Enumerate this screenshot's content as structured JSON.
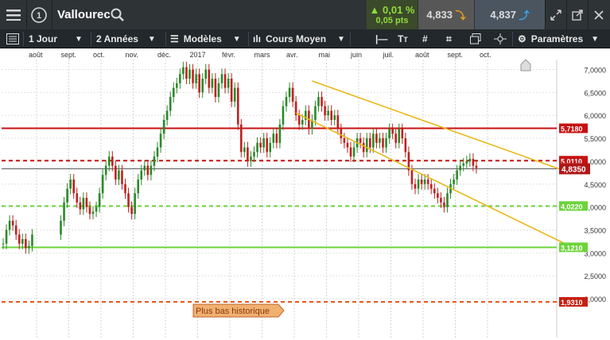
{
  "header": {
    "menu_icon": "hamburger-menu-icon",
    "instrument_icon": "number-one-circle-icon",
    "instrument_badge": "1",
    "title": "Vallourec",
    "search_icon": "search-icon",
    "change_pct": "0,01 %",
    "change_pts": "0,05 pts",
    "bid": "4,833",
    "ask": "4,837",
    "fullscreen_icon": "expand-icon",
    "popout_icon": "external-window-icon",
    "close_icon": "close-icon"
  },
  "toolbar": {
    "period": "1 Jour",
    "range": "2 Années",
    "models": "Modèles",
    "indicator": "Cours Moyen",
    "params": "Paramètres"
  },
  "chart_data": {
    "type": "candlestick",
    "x_tick_labels": [
      "août",
      "sept.",
      "oct.",
      "nov.",
      "déc.",
      "2017",
      "févr.",
      "mars",
      "avr.",
      "mai",
      "juin",
      "juil.",
      "août",
      "sept.",
      "oct."
    ],
    "y_tick_labels": [
      "7,0000",
      "6,5000",
      "6,0000",
      "5,5000",
      "5,0000",
      "4,5000",
      "4,0000",
      "3,5000",
      "3,0000",
      "2,5000",
      "2,0000"
    ],
    "ylim": [
      1.9,
      7.1
    ],
    "price_line": {
      "value": 4.835,
      "label": "4,8350",
      "color": "#b01818"
    },
    "levels": [
      {
        "value": 5.718,
        "label": "5,7180",
        "style": "solid",
        "color": "#c81010"
      },
      {
        "value": 5.011,
        "label": "5,0110",
        "style": "dashed",
        "color": "#c81010"
      },
      {
        "value": 4.022,
        "label": "4,0220",
        "style": "dashed",
        "color": "#6cd43a"
      },
      {
        "value": 3.121,
        "label": "3,1210",
        "style": "solid",
        "color": "#6cd43a"
      },
      {
        "value": 1.931,
        "label": "1,9310",
        "style": "dashed",
        "color": "#e8581a"
      }
    ],
    "annotation": "Plus bas historique",
    "series": [
      {
        "month": "août",
        "closes": [
          3.2,
          3.5,
          3.7,
          3.6,
          3.4,
          3.2,
          3.3,
          3.1,
          3.15,
          3.4
        ]
      },
      {
        "month": "sept.",
        "closes": [
          3.7,
          4.1,
          4.4,
          4.6,
          4.3,
          4.1,
          3.95,
          4.2,
          4.0,
          3.85
        ]
      },
      {
        "month": "oct.",
        "closes": [
          3.9,
          4.0,
          4.3,
          4.7,
          4.9,
          5.1,
          4.9,
          4.6,
          4.8,
          4.5
        ]
      },
      {
        "month": "nov.",
        "closes": [
          4.3,
          4.0,
          3.85,
          4.3,
          4.6,
          4.8,
          4.9,
          4.7,
          4.9,
          5.1
        ]
      },
      {
        "month": "déc.",
        "closes": [
          5.3,
          5.6,
          5.9,
          6.1,
          6.4,
          6.6,
          6.7,
          6.9,
          7.05,
          6.8
        ]
      },
      {
        "month": "2017",
        "closes": [
          7.0,
          6.7,
          6.9,
          6.5,
          6.8,
          7.0,
          6.6,
          6.8,
          6.4,
          6.7
        ]
      },
      {
        "month": "févr.",
        "closes": [
          6.9,
          6.6,
          6.8,
          6.3,
          6.6,
          5.8,
          5.2,
          5.3,
          5.0,
          5.1
        ]
      },
      {
        "month": "mars",
        "closes": [
          5.2,
          5.4,
          5.3,
          5.5,
          5.2,
          5.4,
          5.6,
          5.4,
          5.8,
          6.2
        ]
      },
      {
        "month": "avr.",
        "closes": [
          6.4,
          6.6,
          6.3,
          6.0,
          5.8,
          5.9,
          6.1,
          5.7,
          5.9,
          6.2
        ]
      },
      {
        "month": "mai",
        "closes": [
          6.4,
          6.2,
          6.0,
          6.1,
          5.9,
          6.0,
          5.7,
          5.5,
          5.4,
          5.3
        ]
      },
      {
        "month": "juin",
        "closes": [
          5.1,
          5.3,
          5.5,
          5.4,
          5.2,
          5.5,
          5.3,
          5.6,
          5.4,
          5.5
        ]
      },
      {
        "month": "juil.",
        "closes": [
          5.3,
          5.5,
          5.7,
          5.6,
          5.4,
          5.7,
          5.5,
          5.2,
          4.8,
          4.5
        ]
      },
      {
        "month": "août",
        "closes": [
          4.4,
          4.6,
          4.5,
          4.6,
          4.5,
          4.4,
          4.3,
          4.2,
          4.1,
          4.0
        ]
      },
      {
        "month": "sept.",
        "closes": [
          4.3,
          4.5,
          4.6,
          4.8,
          4.9,
          4.95,
          5.0,
          5.05,
          4.9,
          4.85
        ]
      }
    ],
    "trendlines": [
      {
        "from": {
          "month_index": 9,
          "value": 6.75
        },
        "to": {
          "month_index": 17,
          "value": 4.75
        }
      },
      {
        "from": {
          "month_index": 8.5,
          "value": 6.05
        },
        "to": {
          "month_index": 17,
          "value": 3.15
        }
      }
    ]
  }
}
